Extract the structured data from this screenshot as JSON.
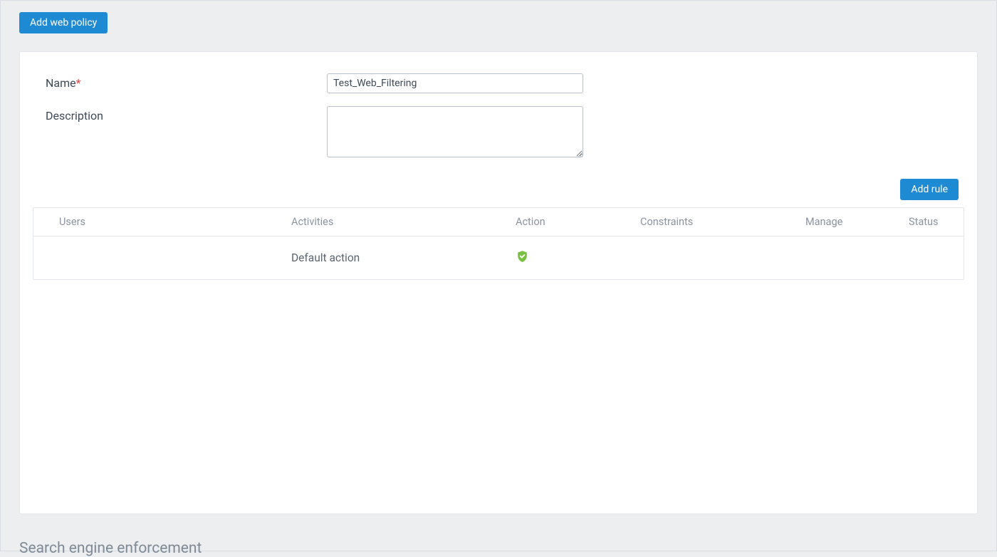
{
  "header": {
    "add_policy_label": "Add web policy"
  },
  "form": {
    "name_label": "Name",
    "name_value": "Test_Web_Filtering",
    "description_label": "Description",
    "description_value": ""
  },
  "rules": {
    "add_rule_label": "Add rule",
    "columns": {
      "users": "Users",
      "activities": "Activities",
      "action": "Action",
      "constraints": "Constraints",
      "manage": "Manage",
      "status": "Status"
    },
    "rows": [
      {
        "users": "",
        "activities": "Default action",
        "action": "shield-check",
        "constraints": "",
        "manage": "",
        "status": ""
      }
    ]
  },
  "section": {
    "search_engine_title": "Search engine enforcement"
  },
  "icons": {
    "shield_check_color": "#7ac142"
  }
}
